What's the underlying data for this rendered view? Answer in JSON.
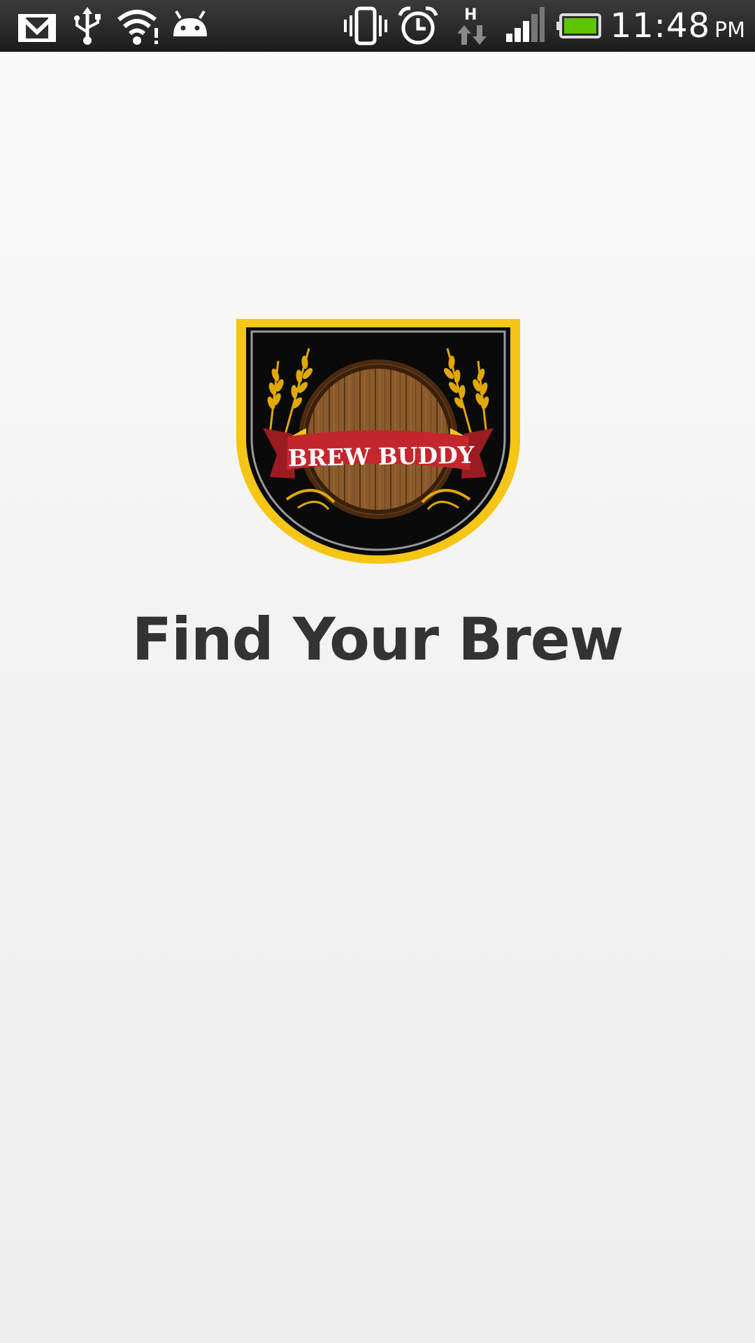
{
  "status_bar": {
    "time": "11:48",
    "am_pm": "PM",
    "network_type": "H",
    "icons": [
      "gmail-icon",
      "usb-icon",
      "wifi-icon",
      "android-icon",
      "vibrate-icon",
      "alarm-icon",
      "data-transfer-icon",
      "signal-icon",
      "battery-icon"
    ],
    "battery_color": "#5cc500"
  },
  "splash": {
    "logo_text": "BREW BUDDY",
    "title": "Find Your Brew"
  },
  "colors": {
    "title": "#333333",
    "logo_border": "#f5c518",
    "banner": "#c4262e",
    "barrel": "#8a5a2b"
  }
}
